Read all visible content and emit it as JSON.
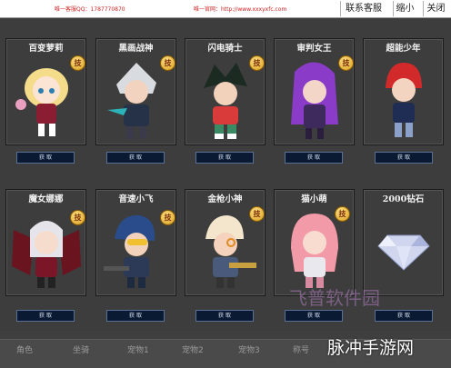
{
  "topbar": {
    "qq_text": "唯一客服QQ：1787770870",
    "site_text": "唯一官网：http://www.xxxyxfc.com",
    "buttons": [
      "联系客服",
      "缩小",
      "关闭"
    ]
  },
  "cards": [
    {
      "title": "百变萝莉",
      "badge": "技",
      "button": "获 取"
    },
    {
      "title": "黑画战神",
      "badge": "技",
      "button": "获 取"
    },
    {
      "title": "闪电骑士",
      "badge": "技",
      "button": "获 取"
    },
    {
      "title": "审判女王",
      "badge": "技",
      "button": "获 取"
    },
    {
      "title": "超能少年",
      "badge": "技",
      "button": "获 取"
    },
    {
      "title": "魔女娜娜",
      "badge": "技",
      "button": "获 取"
    },
    {
      "title": "音速小飞",
      "badge": "技",
      "button": "获 取"
    },
    {
      "title": "金枪小神",
      "badge": "技",
      "button": "获 取"
    },
    {
      "title": "猫小萌",
      "badge": "技",
      "button": "获 取"
    },
    {
      "title": "2000钻石",
      "badge": "",
      "button": "获 取"
    }
  ],
  "tabs": [
    "角色",
    "坐骑",
    "宠物1",
    "宠物2",
    "宠物3",
    "称号"
  ],
  "watermarks": {
    "site_logo": "飞普软件园",
    "corner_brand": "脉冲手游网"
  },
  "colors": {
    "background": "#3d3d3d",
    "button_bg": "#0b1a33",
    "title_text": "#f2f2f2",
    "badge": "#e8b43a"
  }
}
